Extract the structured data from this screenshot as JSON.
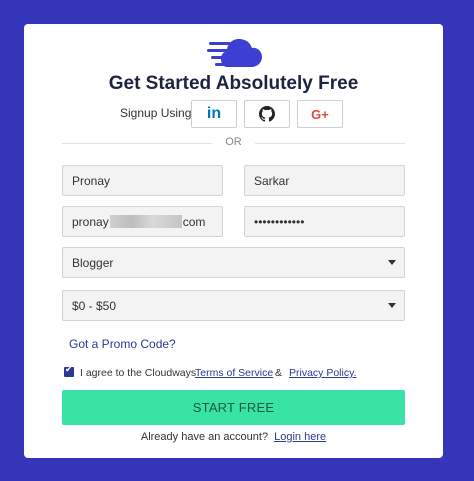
{
  "heading": "Get Started Absolutely Free",
  "signup": {
    "label": "Signup Using",
    "buttons": [
      {
        "icon": "linkedin-icon",
        "text": "in"
      },
      {
        "icon": "github-icon"
      },
      {
        "icon": "google-plus-icon",
        "text": "G+"
      }
    ]
  },
  "divider": "OR",
  "form": {
    "first_name": "Pronay",
    "last_name": "Sarkar",
    "email_start": "pronay",
    "email_end": "com",
    "password": "••••••••••••",
    "role": "Blogger",
    "budget": "$0 - $50"
  },
  "promo_link": "Got a Promo Code?",
  "agreement": {
    "text": "I agree to the Cloudways",
    "terms": "Terms of Service",
    "amp": "&",
    "privacy": "Privacy Policy."
  },
  "submit_label": "START FREE",
  "login": {
    "prompt": "Already have an account?",
    "link": "Login here"
  },
  "colors": {
    "background": "#3435b8",
    "brand": "#3b3fd4",
    "button": "#38e3a4",
    "link": "#2a3a8f"
  }
}
